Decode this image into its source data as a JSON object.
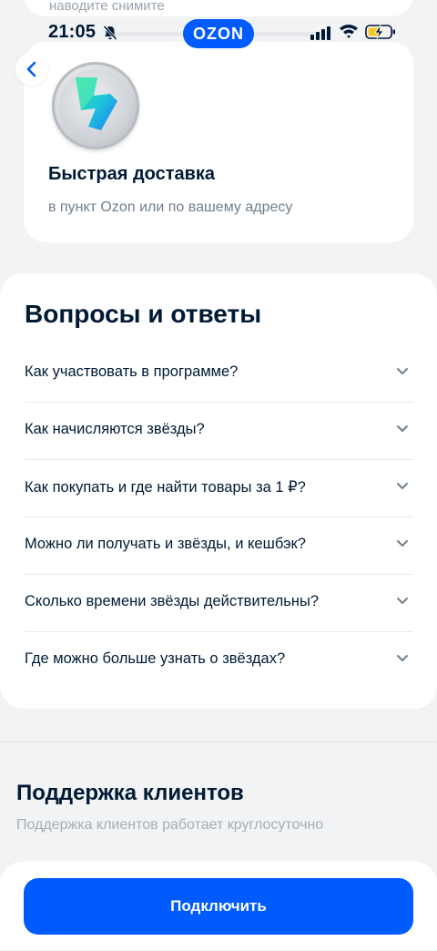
{
  "top_card": {
    "partial_text": "наводите снимите"
  },
  "status_bar": {
    "time": "21:05",
    "brand": "OZON",
    "icons": [
      "bell-slash-icon",
      "signal-icon",
      "wifi-icon",
      "battery-charging-icon"
    ]
  },
  "nav": {
    "back_icon": "chevron-left-icon"
  },
  "delivery": {
    "icon": "lightning-coin-icon",
    "title": "Быстрая доставка",
    "subtitle": "в пункт Ozon или по вашему адресу"
  },
  "faq": {
    "title": "Вопросы и ответы",
    "items": [
      {
        "question": "Как участвовать в программе?"
      },
      {
        "question": "Как начисляются звёзды?"
      },
      {
        "question": "Как покупать и где найти товары за 1 ₽?"
      },
      {
        "question": "Можно ли получать и звёзды, и кешбэк?"
      },
      {
        "question": "Сколько времени звёзды действительны?"
      },
      {
        "question": "Где можно больше узнать о звёздах?"
      }
    ]
  },
  "support": {
    "title": "Поддержка клиентов",
    "subtitle": "Поддержка клиентов работает круглосуточно"
  },
  "cta": {
    "label": "Подключить"
  },
  "colors": {
    "accent": "#005bff",
    "background": "#f2f3f5",
    "text": "#001a34",
    "muted": "#707f8d"
  }
}
